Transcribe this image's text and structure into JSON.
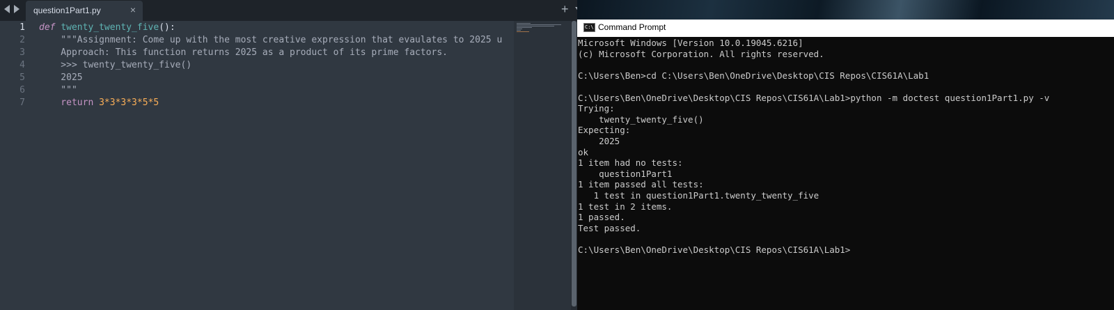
{
  "editor": {
    "tab": {
      "filename": "question1Part1.py",
      "close": "×"
    },
    "add_tab": "+",
    "line_numbers": [
      "1",
      "2",
      "3",
      "4",
      "5",
      "6",
      "7"
    ],
    "code": {
      "l1": {
        "kw": "def",
        "name": "twenty_twenty_five",
        "paren": "():"
      },
      "l2": "    \"\"\"Assignment: Come up with the most creative expression that evaulates to 2025 u",
      "l3": "    Approach: This function returns 2025 as a product of its prime factors.",
      "l4": "    >>> twenty_twenty_five()",
      "l5": "    2025",
      "l6": "    \"\"\"",
      "l7": {
        "kw": "    return ",
        "expr": "3*3*3*3*5*5"
      }
    }
  },
  "cmd": {
    "title": "Command Prompt",
    "icon_text": "C:\\",
    "lines": [
      "Microsoft Windows [Version 10.0.19045.6216]",
      "(c) Microsoft Corporation. All rights reserved.",
      "",
      "C:\\Users\\Ben>cd C:\\Users\\Ben\\OneDrive\\Desktop\\CIS Repos\\CIS61A\\Lab1",
      "",
      "C:\\Users\\Ben\\OneDrive\\Desktop\\CIS Repos\\CIS61A\\Lab1>python -m doctest question1Part1.py -v",
      "Trying:",
      "    twenty_twenty_five()",
      "Expecting:",
      "    2025",
      "ok",
      "1 item had no tests:",
      "    question1Part1",
      "1 item passed all tests:",
      "   1 test in question1Part1.twenty_twenty_five",
      "1 test in 2 items.",
      "1 passed.",
      "Test passed.",
      "",
      "C:\\Users\\Ben\\OneDrive\\Desktop\\CIS Repos\\CIS61A\\Lab1>"
    ]
  }
}
